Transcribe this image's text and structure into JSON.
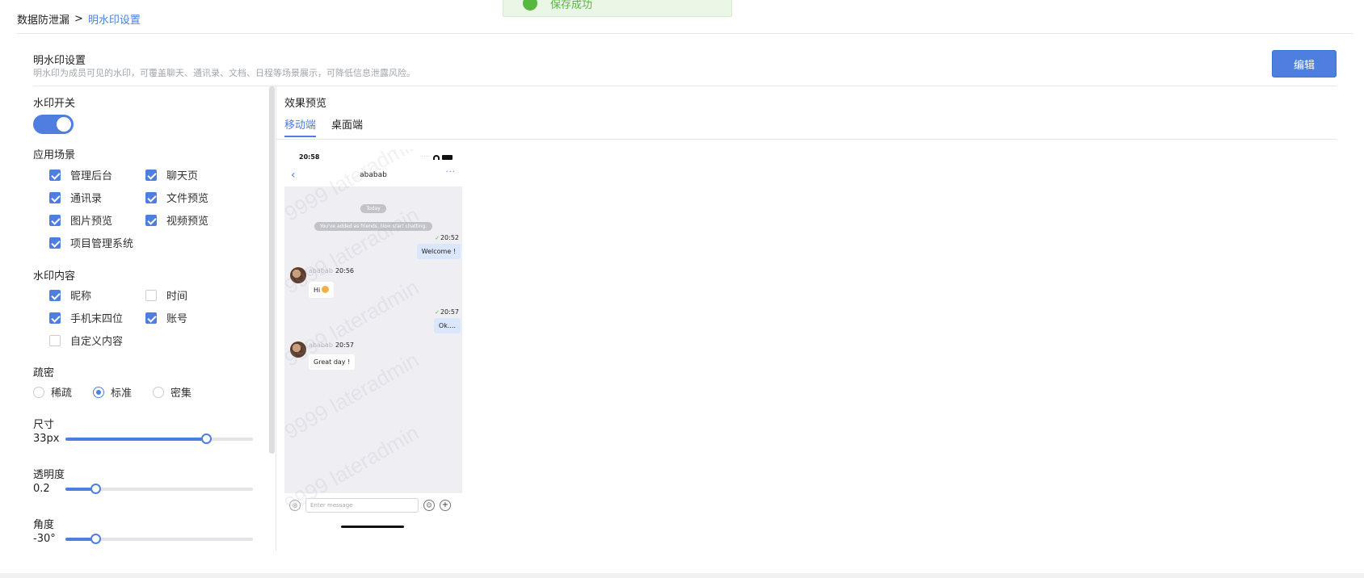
{
  "toast": {
    "text": "保存成功"
  },
  "breadcrumb": {
    "root": "数据防泄漏",
    "separator": ">",
    "current": "明水印设置"
  },
  "header": {
    "title": "明水印设置",
    "description": "明水印为成员可见的水印，可覆盖聊天、通讯录、文档、日程等场景展示，可降低信息泄露风险。",
    "edit_label": "编辑"
  },
  "settings": {
    "switch_label": "水印开关",
    "switch_on": true,
    "scenes_label": "应用场景",
    "scenes": [
      {
        "label": "管理后台",
        "checked": true
      },
      {
        "label": "聊天页",
        "checked": true
      },
      {
        "label": "通讯录",
        "checked": true
      },
      {
        "label": "文件预览",
        "checked": true
      },
      {
        "label": "图片预览",
        "checked": true
      },
      {
        "label": "视频预览",
        "checked": true
      },
      {
        "label": "项目管理系统",
        "checked": true
      }
    ],
    "content_label": "水印内容",
    "contents": [
      {
        "label": "昵称",
        "checked": true
      },
      {
        "label": "时间",
        "checked": false
      },
      {
        "label": "手机末四位",
        "checked": true
      },
      {
        "label": "账号",
        "checked": true
      },
      {
        "label": "自定义内容",
        "checked": false
      }
    ],
    "density_label": "疏密",
    "density_options": [
      "稀疏",
      "标准",
      "密集"
    ],
    "density_selected": "标准",
    "size_label": "尺寸",
    "size_value": "33px",
    "size_fraction": 0.75,
    "opacity_label": "透明度",
    "opacity_value": "0.2",
    "opacity_fraction": 0.16,
    "angle_label": "角度",
    "angle_value": "-30°",
    "angle_fraction": 0.16
  },
  "preview": {
    "title": "效果预览",
    "tabs": [
      {
        "label": "移动端",
        "active": true
      },
      {
        "label": "桌面端",
        "active": false
      }
    ],
    "phone": {
      "time": "20:58",
      "contact_name": "ababab",
      "today_label": "Today",
      "added_notice": "You've added as friends. Now start chatting.",
      "messages": [
        {
          "from": "me",
          "time": "20:52",
          "text": "Welcome !"
        },
        {
          "from": "other",
          "sender": "ababab",
          "time": "20:56",
          "text": "Hi"
        },
        {
          "from": "me",
          "time": "20:57",
          "text": "Ok...."
        },
        {
          "from": "other",
          "sender": "ababab",
          "time": "20:57",
          "text": "Great day !"
        }
      ],
      "input_placeholder": "Enter message",
      "watermark_text": "9999 lateradmin"
    }
  }
}
